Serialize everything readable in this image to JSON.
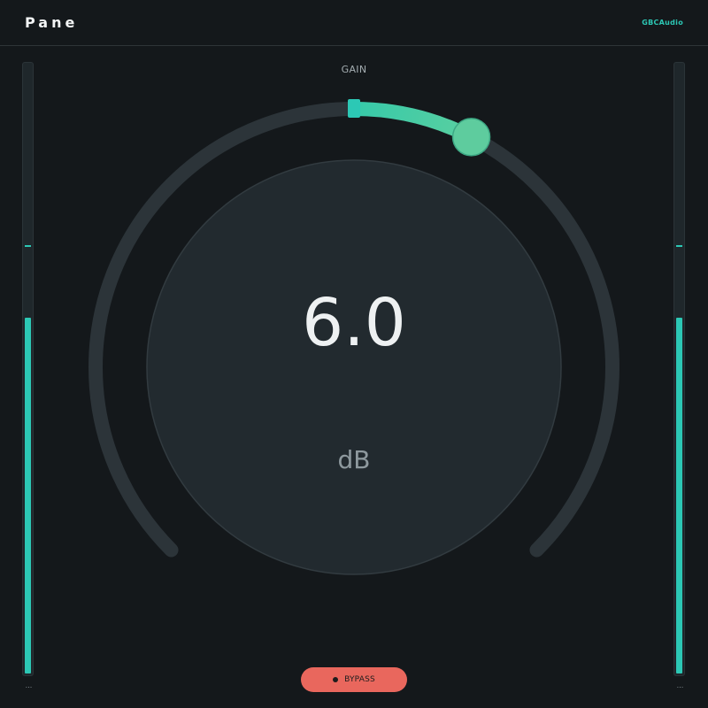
{
  "header": {
    "title": "Pane",
    "brand": "GBCAudio"
  },
  "meters": {
    "left": {
      "level": 0.585,
      "peak": 0.7,
      "readout": "..."
    },
    "right": {
      "level": 0.585,
      "peak": 0.7,
      "readout": "..."
    }
  },
  "knob": {
    "label": "GAIN",
    "value": "6.0",
    "unit": "dB",
    "position": 0.6
  },
  "bypass": {
    "label": "BYPASS"
  },
  "colors": {
    "accent": "#2cc8b5",
    "arc_gradient_start": "#36c9a9",
    "arc_gradient_end": "#63d19e",
    "bypass": "#e9675d"
  }
}
